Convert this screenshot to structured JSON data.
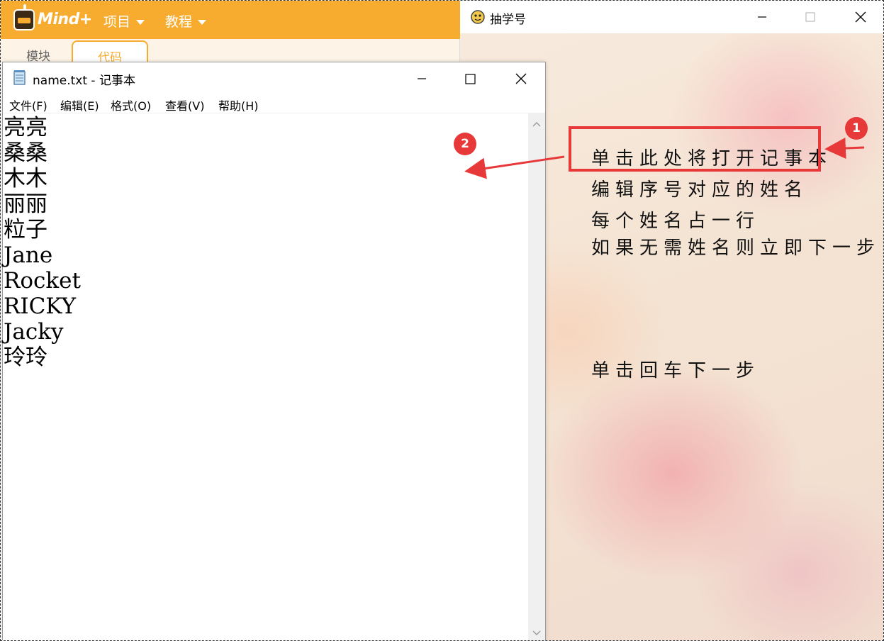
{
  "mind_plus": {
    "logo_text": "Mind+",
    "menus": [
      {
        "label": "项目"
      },
      {
        "label": "教程"
      }
    ],
    "tabs": {
      "blocks": "模块",
      "code": "代码"
    }
  },
  "game_window": {
    "title": "抽学号",
    "instructions": [
      "单击此处将打开记事本",
      "编辑序号对应的姓名",
      "每个姓名占一行",
      "如果无需姓名则立即下一步"
    ],
    "next_hint": "单击回车下一步",
    "highlight_color": "#e8393a"
  },
  "notepad": {
    "title": "name.txt - 记事本",
    "menus": [
      "文件(F)",
      "编辑(E)",
      "格式(O)",
      "查看(V)",
      "帮助(H)"
    ],
    "lines": [
      "亮亮",
      "桑桑",
      "木木",
      "丽丽",
      "粒子",
      "Jane",
      "Rocket",
      "RICKY",
      "Jacky",
      "玲玲"
    ]
  },
  "annotations": {
    "badge_1": "1",
    "badge_2": "2"
  },
  "colors": {
    "mind_orange": "#f7ac2f",
    "annotation_red": "#e8393a"
  }
}
